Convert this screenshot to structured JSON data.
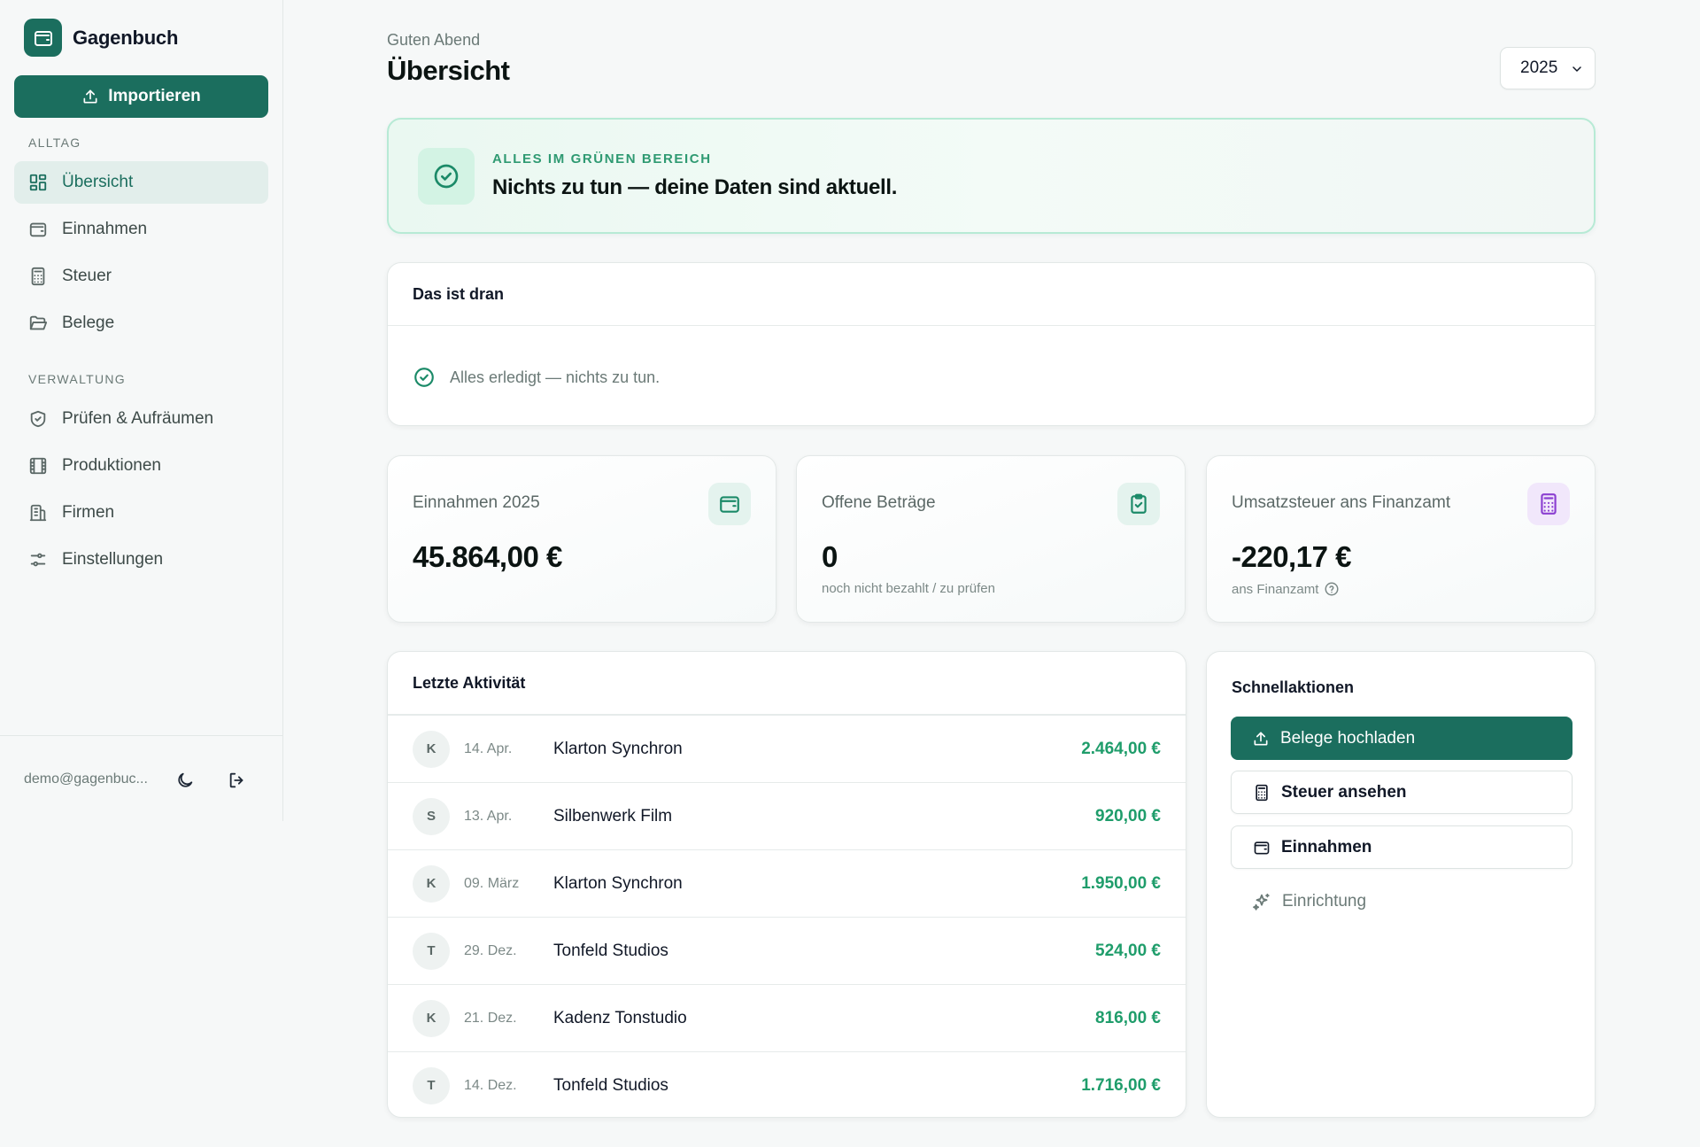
{
  "sidebar": {
    "brand": "Gagenbuch",
    "import_label": "Importieren",
    "section_everyday": "ALLTAG",
    "section_admin": "VERWALTUNG",
    "items": [
      {
        "label": "Übersicht"
      },
      {
        "label": "Einnahmen"
      },
      {
        "label": "Steuer"
      },
      {
        "label": "Belege"
      },
      {
        "label": "Prüfen & Aufräumen"
      },
      {
        "label": "Produktionen"
      },
      {
        "label": "Firmen"
      },
      {
        "label": "Einstellungen"
      }
    ],
    "user_email": "demo@gagenbuc..."
  },
  "header": {
    "greeting": "Guten Abend",
    "title": "Übersicht",
    "year": "2025"
  },
  "status": {
    "kicker": "ALLES IM GRÜNEN BEREICH",
    "message": "Nichts zu tun — deine Daten sind aktuell."
  },
  "todo": {
    "title": "Das ist dran",
    "empty_text": "Alles erledigt — nichts zu tun."
  },
  "kpis": [
    {
      "label": "Einnahmen 2025",
      "value": "45.864,00 €",
      "sub": ""
    },
    {
      "label": "Offene Beträge",
      "value": "0",
      "sub": "noch nicht bezahlt / zu prüfen"
    },
    {
      "label": "Umsatzsteuer ans Finanzamt",
      "value": "-220,17 €",
      "sub": "ans Finanzamt"
    }
  ],
  "activity": {
    "title": "Letzte Aktivität",
    "rows": [
      {
        "initial": "K",
        "date": "14. Apr.",
        "name": "Klarton Synchron",
        "amount": "2.464,00 €"
      },
      {
        "initial": "S",
        "date": "13. Apr.",
        "name": "Silbenwerk Film",
        "amount": "920,00 €"
      },
      {
        "initial": "K",
        "date": "09. März",
        "name": "Klarton Synchron",
        "amount": "1.950,00 €"
      },
      {
        "initial": "T",
        "date": "29. Dez.",
        "name": "Tonfeld Studios",
        "amount": "524,00 €"
      },
      {
        "initial": "K",
        "date": "21. Dez.",
        "name": "Kadenz Tonstudio",
        "amount": "816,00 €"
      },
      {
        "initial": "T",
        "date": "14. Dez.",
        "name": "Tonfeld Studios",
        "amount": "1.716,00 €"
      }
    ]
  },
  "quick_actions": {
    "title": "Schnellaktionen",
    "upload": "Belege hochladen",
    "tax": "Steuer ansehen",
    "income": "Einnahmen",
    "setup": "Einrichtung"
  },
  "colors": {
    "accent": "#1b6e5e",
    "positive": "#1f9d6b",
    "banner_bg": "#eaf8f1",
    "purple": "#8b3fd1"
  }
}
